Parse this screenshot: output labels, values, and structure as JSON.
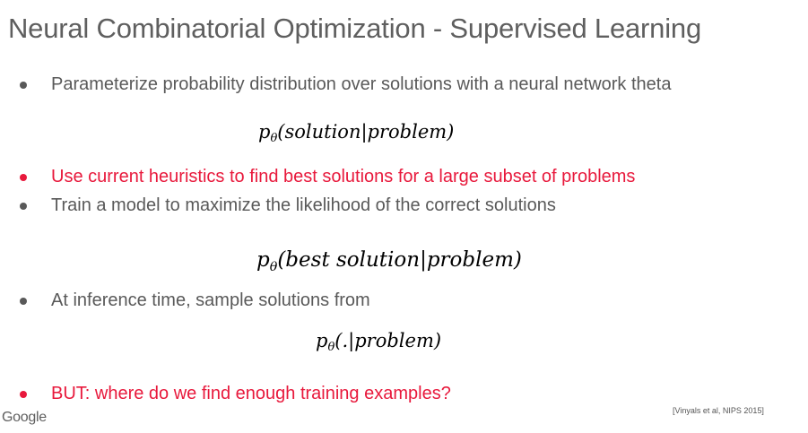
{
  "slide": {
    "title": "Neural Combinatorial Optimization - Supervised Learning",
    "bullets": [
      {
        "text": "Parameterize probability distribution over solutions with a neural network theta",
        "color": "#595959"
      },
      {
        "text": "Use current heuristics to find best solutions for a large subset of problems",
        "color": "#e8193c"
      },
      {
        "text": "Train a model to maximize the likelihood of the correct solutions",
        "color": "#595959"
      },
      {
        "text": "At inference time, sample solutions from",
        "color": "#595959"
      },
      {
        "text": "BUT: where do we find enough training examples?",
        "color": "#e8193c"
      }
    ],
    "formulas": [
      {
        "base": "p",
        "subscript": "θ",
        "body": "(solution|problem)"
      },
      {
        "base": "p",
        "subscript": "θ",
        "body": "(best solution|problem)"
      },
      {
        "base": "p",
        "subscript": "θ",
        "body": "(.|problem)"
      }
    ],
    "footer": {
      "logo_text": "Google",
      "citation": "[Vinyals et al, NIPS 2015]"
    }
  }
}
